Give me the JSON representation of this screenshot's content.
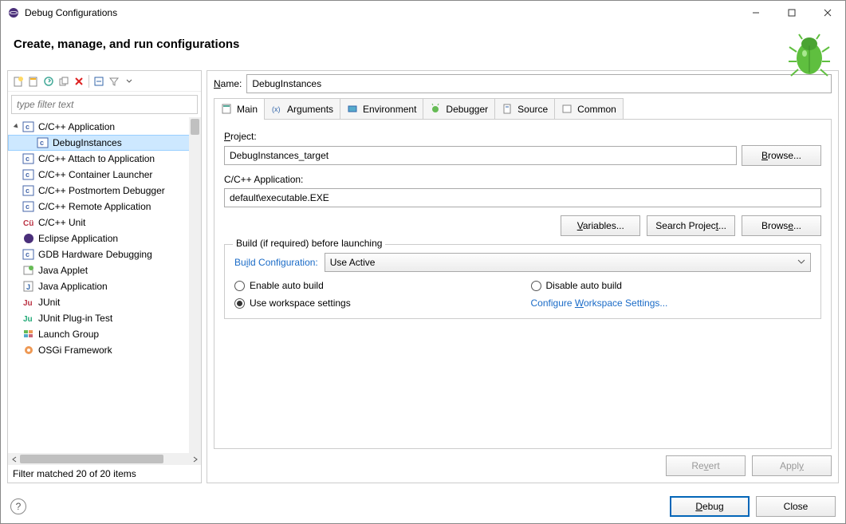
{
  "window": {
    "title": "Debug Configurations"
  },
  "header": {
    "heading": "Create, manage, and run configurations"
  },
  "filter": {
    "placeholder": "type filter text"
  },
  "tree": {
    "matched": "Filter matched 20 of 20 items",
    "items": [
      {
        "label": "C/C++ Application",
        "depth": 0,
        "expandable": true,
        "expanded": true,
        "icon": "c"
      },
      {
        "label": "DebugInstances",
        "depth": 1,
        "selected": true,
        "icon": "c"
      },
      {
        "label": "C/C++ Attach to Application",
        "depth": 0,
        "icon": "c"
      },
      {
        "label": "C/C++ Container Launcher",
        "depth": 0,
        "icon": "c"
      },
      {
        "label": "C/C++ Postmortem Debugger",
        "depth": 0,
        "icon": "c"
      },
      {
        "label": "C/C++ Remote Application",
        "depth": 0,
        "icon": "c"
      },
      {
        "label": "C/C++ Unit",
        "depth": 0,
        "icon": "cu"
      },
      {
        "label": "Eclipse Application",
        "depth": 0,
        "icon": "ec"
      },
      {
        "label": "GDB Hardware Debugging",
        "depth": 0,
        "icon": "c"
      },
      {
        "label": "Java Applet",
        "depth": 0,
        "icon": "ja"
      },
      {
        "label": "Java Application",
        "depth": 0,
        "icon": "j"
      },
      {
        "label": "JUnit",
        "depth": 0,
        "icon": "ju"
      },
      {
        "label": "JUnit Plug-in Test",
        "depth": 0,
        "icon": "jup"
      },
      {
        "label": "Launch Group",
        "depth": 0,
        "icon": "lg"
      },
      {
        "label": "OSGi Framework",
        "depth": 0,
        "icon": "os"
      }
    ]
  },
  "name": {
    "label_pre": "N",
    "label_post": "ame:",
    "value": "DebugInstances"
  },
  "tabs": [
    "Main",
    "Arguments",
    "Environment",
    "Debugger",
    "Source",
    "Common"
  ],
  "main_tab": {
    "project_label_pre": "P",
    "project_label_post": "roject:",
    "project_value": "DebugInstances_target",
    "browse1_pre": "B",
    "browse1_post": "rowse...",
    "app_label": "C/C++ Application:",
    "app_value": "default\\executable.EXE",
    "variables_pre": "V",
    "variables_post": "ariables...",
    "search_label": "Search Projec",
    "search_u": "t",
    "search_post": "...",
    "browse2_label": "Brows",
    "browse2_u": "e",
    "browse2_post": "...",
    "group_legend": "Build (if required) before launching",
    "build_cfg_label": "Build Configuration:",
    "build_cfg_u": "i",
    "build_cfg_value": "Use Active",
    "rad_enable_pre": "E",
    "rad_enable_post": "nable auto build",
    "rad_disable_pre": "D",
    "rad_disable_post": "isable auto build",
    "rad_workspace": "Use workspace settings",
    "cfg_link_pre": "Configure ",
    "cfg_link_u": "W",
    "cfg_link_post": "orkspace Settings..."
  },
  "bottom": {
    "revert_pre": "Re",
    "revert_u": "v",
    "revert_post": "ert",
    "apply_label": "Appl",
    "apply_u": "y"
  },
  "footer": {
    "debug_pre": "D",
    "debug_post": "ebug",
    "close_label": "Close"
  }
}
